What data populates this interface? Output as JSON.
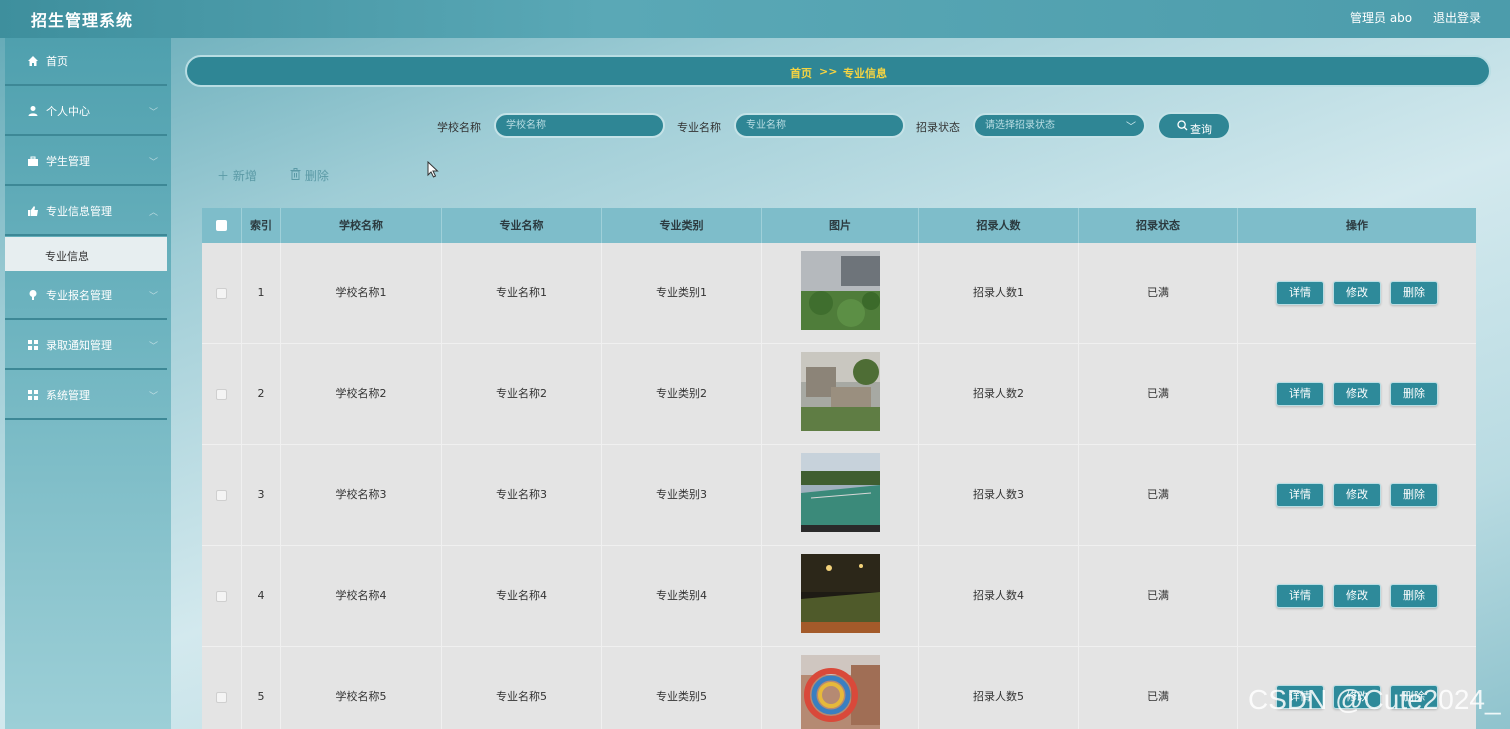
{
  "app": {
    "title": "招生管理系统",
    "admin": "管理员 abo",
    "logout": "退出登录"
  },
  "sidebar": {
    "items": [
      {
        "label": "首页",
        "icon": "home-icon"
      },
      {
        "label": "个人中心",
        "icon": "user-icon"
      },
      {
        "label": "学生管理",
        "icon": "briefcase-icon"
      },
      {
        "label": "专业信息管理",
        "icon": "thumb-icon"
      },
      {
        "label": "专业报名管理",
        "icon": "pin-icon"
      },
      {
        "label": "录取通知管理",
        "icon": "grid-icon"
      },
      {
        "label": "系统管理",
        "icon": "grid-icon"
      }
    ],
    "submenu_active": "专业信息"
  },
  "breadcrumb": {
    "home": "首页",
    "sep": ">>",
    "current": "专业信息"
  },
  "search": {
    "school_label": "学校名称",
    "school_placeholder": "学校名称",
    "major_label": "专业名称",
    "major_placeholder": "专业名称",
    "status_label": "招录状态",
    "status_placeholder": "请选择招录状态",
    "button": "查询"
  },
  "toolbar": {
    "add": "新增",
    "delete": "删除"
  },
  "table": {
    "headers": [
      "索引",
      "学校名称",
      "专业名称",
      "专业类别",
      "图片",
      "招录人数",
      "招录状态",
      "操作"
    ],
    "rows": [
      {
        "index": "1",
        "school": "学校名称1",
        "major": "专业名称1",
        "category": "专业类别1",
        "count": "招录人数1",
        "status": "已满"
      },
      {
        "index": "2",
        "school": "学校名称2",
        "major": "专业名称2",
        "category": "专业类别2",
        "count": "招录人数2",
        "status": "已满"
      },
      {
        "index": "3",
        "school": "学校名称3",
        "major": "专业名称3",
        "category": "专业类别3",
        "count": "招录人数3",
        "status": "已满"
      },
      {
        "index": "4",
        "school": "学校名称4",
        "major": "专业名称4",
        "category": "专业类别4",
        "count": "招录人数4",
        "status": "已满"
      },
      {
        "index": "5",
        "school": "学校名称5",
        "major": "专业名称5",
        "category": "专业类别5",
        "count": "招录人数5",
        "status": "已满"
      }
    ],
    "actions": {
      "detail": "详情",
      "edit": "修改",
      "delete": "删除"
    }
  },
  "watermark": "CSDN @Cute2024_",
  "colors": {
    "accent": "#2f8695",
    "breadcrumb_text": "#f5d442",
    "header_bg": "#7ebdca"
  }
}
